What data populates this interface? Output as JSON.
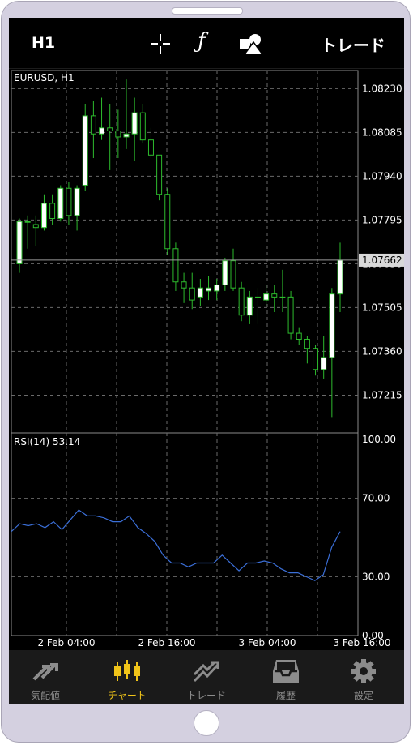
{
  "toolbar": {
    "timeframe": "H1",
    "crosshair_icon": "crosshair-icon",
    "indicators_icon": "function-icon",
    "objects_icon": "objects-icon",
    "trade_label": "トレード"
  },
  "chart_data": [
    {
      "type": "candlestick",
      "title": "EURUSD, H1",
      "symbol": "EURUSD",
      "timeframe": "H1",
      "current_price_label": "1.07662",
      "y_ticks": [
        "1.08230",
        "1.08085",
        "1.07940",
        "1.07795",
        "1.07650",
        "1.07505",
        "1.07360",
        "1.07215"
      ],
      "x_ticks": [
        "2 Feb 04:00",
        "2 Feb 16:00",
        "3 Feb 04:00",
        "3 Feb 16:00"
      ],
      "ylim": [
        1.0709,
        1.0829
      ],
      "candles": [
        {
          "o": 1.0765,
          "h": 1.078,
          "l": 1.0762,
          "c": 1.0779
        },
        {
          "o": 1.0779,
          "h": 1.0781,
          "l": 1.077,
          "c": 1.0779
        },
        {
          "o": 1.0778,
          "h": 1.0781,
          "l": 1.0771,
          "c": 1.0777
        },
        {
          "o": 1.0777,
          "h": 1.0788,
          "l": 1.0776,
          "c": 1.0785
        },
        {
          "o": 1.0785,
          "h": 1.0788,
          "l": 1.0778,
          "c": 1.078
        },
        {
          "o": 1.078,
          "h": 1.0791,
          "l": 1.0779,
          "c": 1.079
        },
        {
          "o": 1.079,
          "h": 1.0792,
          "l": 1.0778,
          "c": 1.0781
        },
        {
          "o": 1.0781,
          "h": 1.0791,
          "l": 1.0776,
          "c": 1.079
        },
        {
          "o": 1.0791,
          "h": 1.0818,
          "l": 1.0789,
          "c": 1.0814
        },
        {
          "o": 1.0814,
          "h": 1.0819,
          "l": 1.08,
          "c": 1.0808
        },
        {
          "o": 1.0808,
          "h": 1.082,
          "l": 1.0806,
          "c": 1.081
        },
        {
          "o": 1.081,
          "h": 1.0818,
          "l": 1.0796,
          "c": 1.0809
        },
        {
          "o": 1.0809,
          "h": 1.0816,
          "l": 1.08,
          "c": 1.0807
        },
        {
          "o": 1.0807,
          "h": 1.0826,
          "l": 1.0803,
          "c": 1.0808
        },
        {
          "o": 1.0808,
          "h": 1.082,
          "l": 1.0799,
          "c": 1.0815
        },
        {
          "o": 1.0815,
          "h": 1.0818,
          "l": 1.0805,
          "c": 1.0806
        },
        {
          "o": 1.0806,
          "h": 1.081,
          "l": 1.08,
          "c": 1.0801
        },
        {
          "o": 1.0801,
          "h": 1.0801,
          "l": 1.0786,
          "c": 1.0788
        },
        {
          "o": 1.0788,
          "h": 1.079,
          "l": 1.0768,
          "c": 1.077
        },
        {
          "o": 1.077,
          "h": 1.0772,
          "l": 1.0756,
          "c": 1.0759
        },
        {
          "o": 1.0759,
          "h": 1.0762,
          "l": 1.0752,
          "c": 1.0757
        },
        {
          "o": 1.0757,
          "h": 1.0762,
          "l": 1.075,
          "c": 1.0753
        },
        {
          "o": 1.0754,
          "h": 1.076,
          "l": 1.0751,
          "c": 1.0757
        },
        {
          "o": 1.0756,
          "h": 1.0761,
          "l": 1.0753,
          "c": 1.0757
        },
        {
          "o": 1.0756,
          "h": 1.076,
          "l": 1.0753,
          "c": 1.0758
        },
        {
          "o": 1.0758,
          "h": 1.0767,
          "l": 1.0756,
          "c": 1.0766
        },
        {
          "o": 1.0766,
          "h": 1.077,
          "l": 1.0756,
          "c": 1.0757
        },
        {
          "o": 1.0757,
          "h": 1.0759,
          "l": 1.0746,
          "c": 1.0748
        },
        {
          "o": 1.0748,
          "h": 1.0756,
          "l": 1.0745,
          "c": 1.0754
        },
        {
          "o": 1.0754,
          "h": 1.0757,
          "l": 1.0745,
          "c": 1.0754
        },
        {
          "o": 1.0753,
          "h": 1.0758,
          "l": 1.0751,
          "c": 1.0755
        },
        {
          "o": 1.0755,
          "h": 1.0758,
          "l": 1.0749,
          "c": 1.0754
        },
        {
          "o": 1.0754,
          "h": 1.0763,
          "l": 1.0749,
          "c": 1.0754
        },
        {
          "o": 1.0754,
          "h": 1.0756,
          "l": 1.074,
          "c": 1.0742
        },
        {
          "o": 1.0742,
          "h": 1.0744,
          "l": 1.0738,
          "c": 1.074
        },
        {
          "o": 1.074,
          "h": 1.0741,
          "l": 1.0732,
          "c": 1.0737
        },
        {
          "o": 1.0737,
          "h": 1.0738,
          "l": 1.0728,
          "c": 1.073
        },
        {
          "o": 1.073,
          "h": 1.0741,
          "l": 1.0727,
          "c": 1.0734
        },
        {
          "o": 1.0734,
          "h": 1.0757,
          "l": 1.0714,
          "c": 1.0755
        },
        {
          "o": 1.0755,
          "h": 1.0772,
          "l": 1.0749,
          "c": 1.07662
        }
      ]
    },
    {
      "type": "line",
      "title": "RSI(14) 53.14",
      "indicator": "RSI(14)",
      "current_value": "53.14",
      "y_ticks": [
        "100.00",
        "70.00",
        "30.00",
        "0.00"
      ],
      "ylim": [
        0,
        100
      ],
      "color": "#3b6fd8",
      "values": [
        53,
        57,
        56,
        57,
        55,
        58,
        54,
        59,
        64,
        61,
        61,
        60,
        58,
        58,
        61,
        55,
        52,
        48,
        41,
        37,
        37,
        35,
        37,
        37,
        37,
        41,
        37,
        33,
        37,
        37,
        38,
        37,
        34,
        32,
        32,
        30,
        28,
        31,
        45,
        53
      ]
    }
  ],
  "tabs": [
    {
      "label": "気配値",
      "icon": "quotes-icon",
      "active": false
    },
    {
      "label": "チャート",
      "icon": "candlestick-chart-icon",
      "active": true
    },
    {
      "label": "トレード",
      "icon": "trade-icon",
      "active": false
    },
    {
      "label": "履歴",
      "icon": "history-icon",
      "active": false
    },
    {
      "label": "設定",
      "icon": "settings-gear-icon",
      "active": false
    }
  ],
  "colors": {
    "background": "#000000",
    "bull_candle": "#ffffff",
    "bear_candle": "#000000",
    "wick": "#2dbb2d",
    "grid": "#6a6a6a",
    "active_tab": "#f0c419",
    "inactive_tab": "#8c8c8c",
    "rsi_line": "#3b6fd8"
  }
}
